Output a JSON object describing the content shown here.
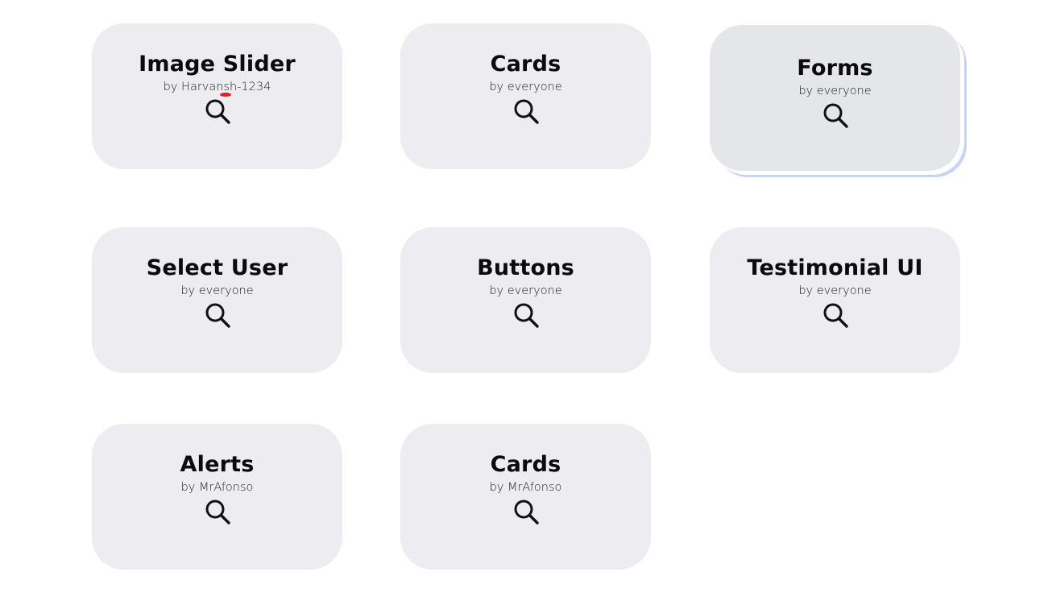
{
  "cards": [
    {
      "title": "Image Slider",
      "author": "by Harvansh-1234",
      "icon": "search-icon"
    },
    {
      "title": "Cards",
      "author": "by everyone",
      "icon": "search-icon"
    },
    {
      "title": "Forms",
      "author": "by everyone",
      "icon": "search-icon"
    },
    {
      "title": "Select User",
      "author": "by everyone",
      "icon": "search-icon"
    },
    {
      "title": "Buttons",
      "author": "by everyone",
      "icon": "search-icon"
    },
    {
      "title": "Testimonial UI",
      "author": "by everyone",
      "icon": "search-icon"
    },
    {
      "title": "Alerts",
      "author": "by MrAfonso",
      "icon": "search-icon"
    },
    {
      "title": "Cards",
      "author": "by MrAfonso",
      "icon": "search-icon"
    }
  ],
  "colors": {
    "card_bg": "#ececf1",
    "card_hover_bg": "#e5e6ea",
    "hover_shadow": "#c5d3fb",
    "title": "#0b0b0b",
    "cursor_marker": "#e02020"
  }
}
